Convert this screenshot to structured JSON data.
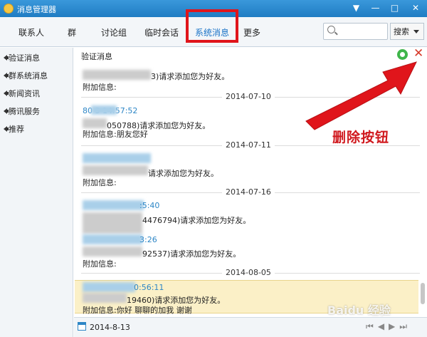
{
  "window": {
    "title": "消息管理器",
    "controls": [
      "▼",
      "—",
      "□",
      "✕"
    ]
  },
  "tabs": [
    {
      "label": "联系人"
    },
    {
      "label": "群"
    },
    {
      "label": "讨论组"
    },
    {
      "label": "临时会话"
    },
    {
      "label": "系统消息",
      "active": true
    },
    {
      "label": "更多"
    }
  ],
  "search": {
    "button_label": "搜索"
  },
  "sidebar": {
    "items": [
      {
        "label": "验证消息"
      },
      {
        "label": "群系统消息"
      },
      {
        "label": "新闻资讯"
      },
      {
        "label": "腾讯服务"
      },
      {
        "label": "推荐"
      }
    ]
  },
  "main": {
    "section_title": "验证消息",
    "messages": [
      {
        "sender": "",
        "line": "3)请求添加您为好友。",
        "extra": "附加信息:"
      },
      {
        "date": "2014-07-10",
        "sender": "80        3 14:57:52",
        "line": "050788)请求添加您为好友。",
        "extra": "附加信息:朋友您好"
      },
      {
        "date": "2014-07-11",
        "sender": "",
        "line": "请求添加您为好友。",
        "extra": "附加信息:"
      },
      {
        "date": "2014-07-16",
        "sender": ":5:40",
        "line": "4476794)请求添加您为好友。",
        "extra": ""
      },
      {
        "sender": "3:26",
        "line": "92537)请求添加您为好友。",
        "extra": "附加信息:"
      },
      {
        "date": "2014-08-05",
        "sender": "0:56:11",
        "line": "19460)请求添加您为好友。",
        "extra": "附加信息:你好 聊聊的加我 谢谢"
      }
    ]
  },
  "footer": {
    "date": "2014-8-13",
    "pager": [
      "⏮",
      "◀",
      "▶",
      "⏭"
    ]
  },
  "annotation": {
    "label": "删除按钮"
  },
  "watermark": {
    "text": "Baidu 经验"
  },
  "colors": {
    "titlebar": "#2a8ad0",
    "highlight_box": "#e0151b",
    "arrow": "#e0151b",
    "accent": "#2d86c6"
  }
}
